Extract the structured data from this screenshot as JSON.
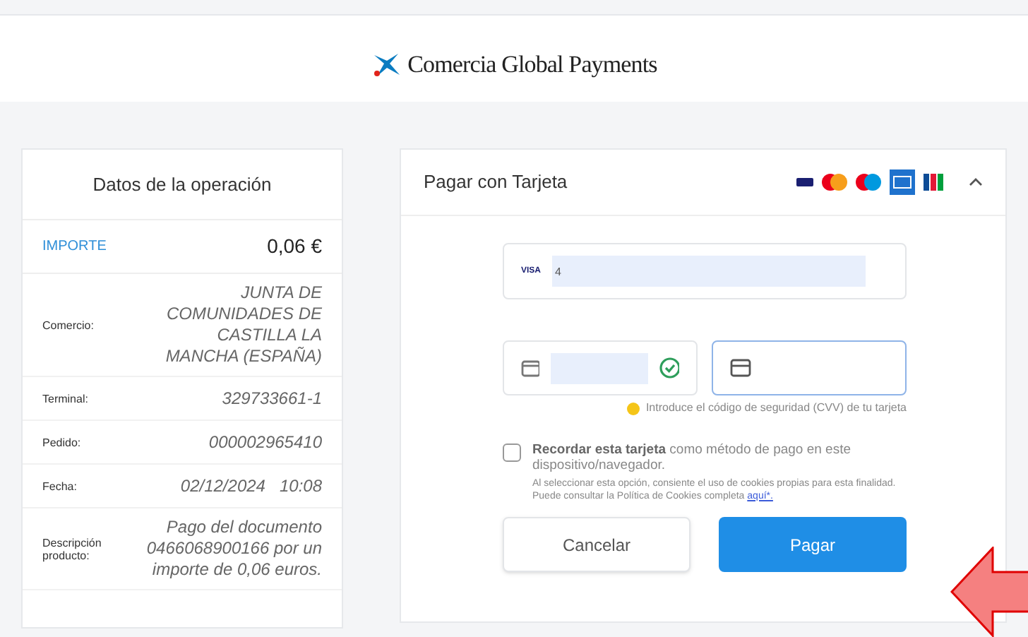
{
  "header": {
    "logo_text": "Comercia Global Payments"
  },
  "operation": {
    "title": "Datos de la operación",
    "rows": [
      {
        "kind": "amount",
        "label": "IMPORTE",
        "value": "0,06 €"
      },
      {
        "kind": "detail",
        "label": "Comercio:",
        "value": "JUNTA DE COMUNIDADES DE CASTILLA LA MANCHA (ESPAÑA)"
      },
      {
        "kind": "detail",
        "label": "Terminal:",
        "value": "329733661-1"
      },
      {
        "kind": "detail",
        "label": "Pedido:",
        "value": "000002965410"
      },
      {
        "kind": "detail",
        "label": "Fecha:",
        "value": "02/12/2024   10:08"
      },
      {
        "kind": "detail",
        "label": "Descripción producto:",
        "value": "Pago del documento 0466068900166 por un importe de 0,06 euros."
      }
    ]
  },
  "payment": {
    "title": "Pagar con Tarjeta",
    "expanded": true,
    "card_number": {
      "brand": "VISA",
      "value": "4"
    },
    "expiry": {
      "valid": true
    },
    "cvv": {
      "focused": true,
      "hint": "Introduce el código de seguridad (CVV) de tu tarjeta"
    },
    "remember": {
      "checked": false,
      "label": "**Recordar esta tarjeta** como método de pago en este dispositivo/navegador.",
      "notice": "Al seleccionar esta opción, consiente el uso de cookies propias para esta finalidad. Puede consultar la Política de Cookies completa",
      "link": "aquí*."
    },
    "buttons": [
      {
        "kind": "secondary",
        "label": "Cancelar"
      },
      {
        "kind": "primary",
        "label": "Pagar"
      }
    ]
  }
}
